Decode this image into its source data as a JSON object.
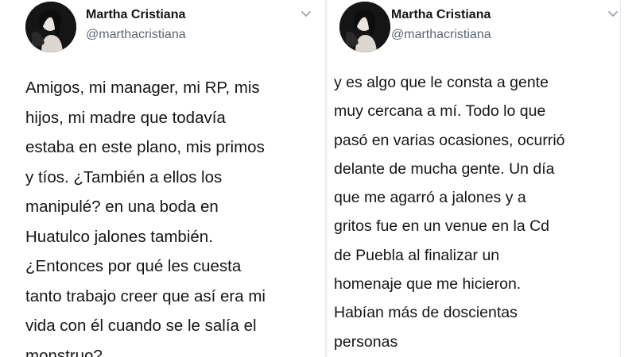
{
  "tweets": [
    {
      "author": {
        "name": "Martha Cristiana",
        "handle": "@marthacristiana"
      },
      "menu_icon": "chevron-down-icon",
      "lines": [
        "Amigos, mi manager, mi RP, mis",
        "hijos, mi madre que todavía",
        "estaba en este plano, mis primos",
        "y tíos. ¿También a ellos los",
        "manipulé? en una boda en",
        "Huatulco jalones también.",
        "¿Entonces por qué les cuesta",
        "tanto trabajo creer que así era mi",
        "vida con él cuando se le salía el",
        "monstruo?"
      ]
    },
    {
      "author": {
        "name": "Martha Cristiana",
        "handle": "@marthacristiana"
      },
      "menu_icon": "chevron-down-icon",
      "lines": [
        "y es algo que le consta a gente",
        "muy cercana a mí. Todo lo que",
        "pasó en varias ocasiones, ocurrió",
        "delante de mucha gente. Un día",
        "que me agarró a jalones y a",
        "gritos fue en un venue en la Cd",
        "de Puebla al finalizar un",
        "homenaje que me hicieron.",
        "Habían más de doscientas",
        "personas"
      ]
    }
  ],
  "colors": {
    "text": "#161616",
    "handle": "#5b6773",
    "chevron": "#9aa3ad",
    "avatar_bg": "#1a1a1a"
  }
}
